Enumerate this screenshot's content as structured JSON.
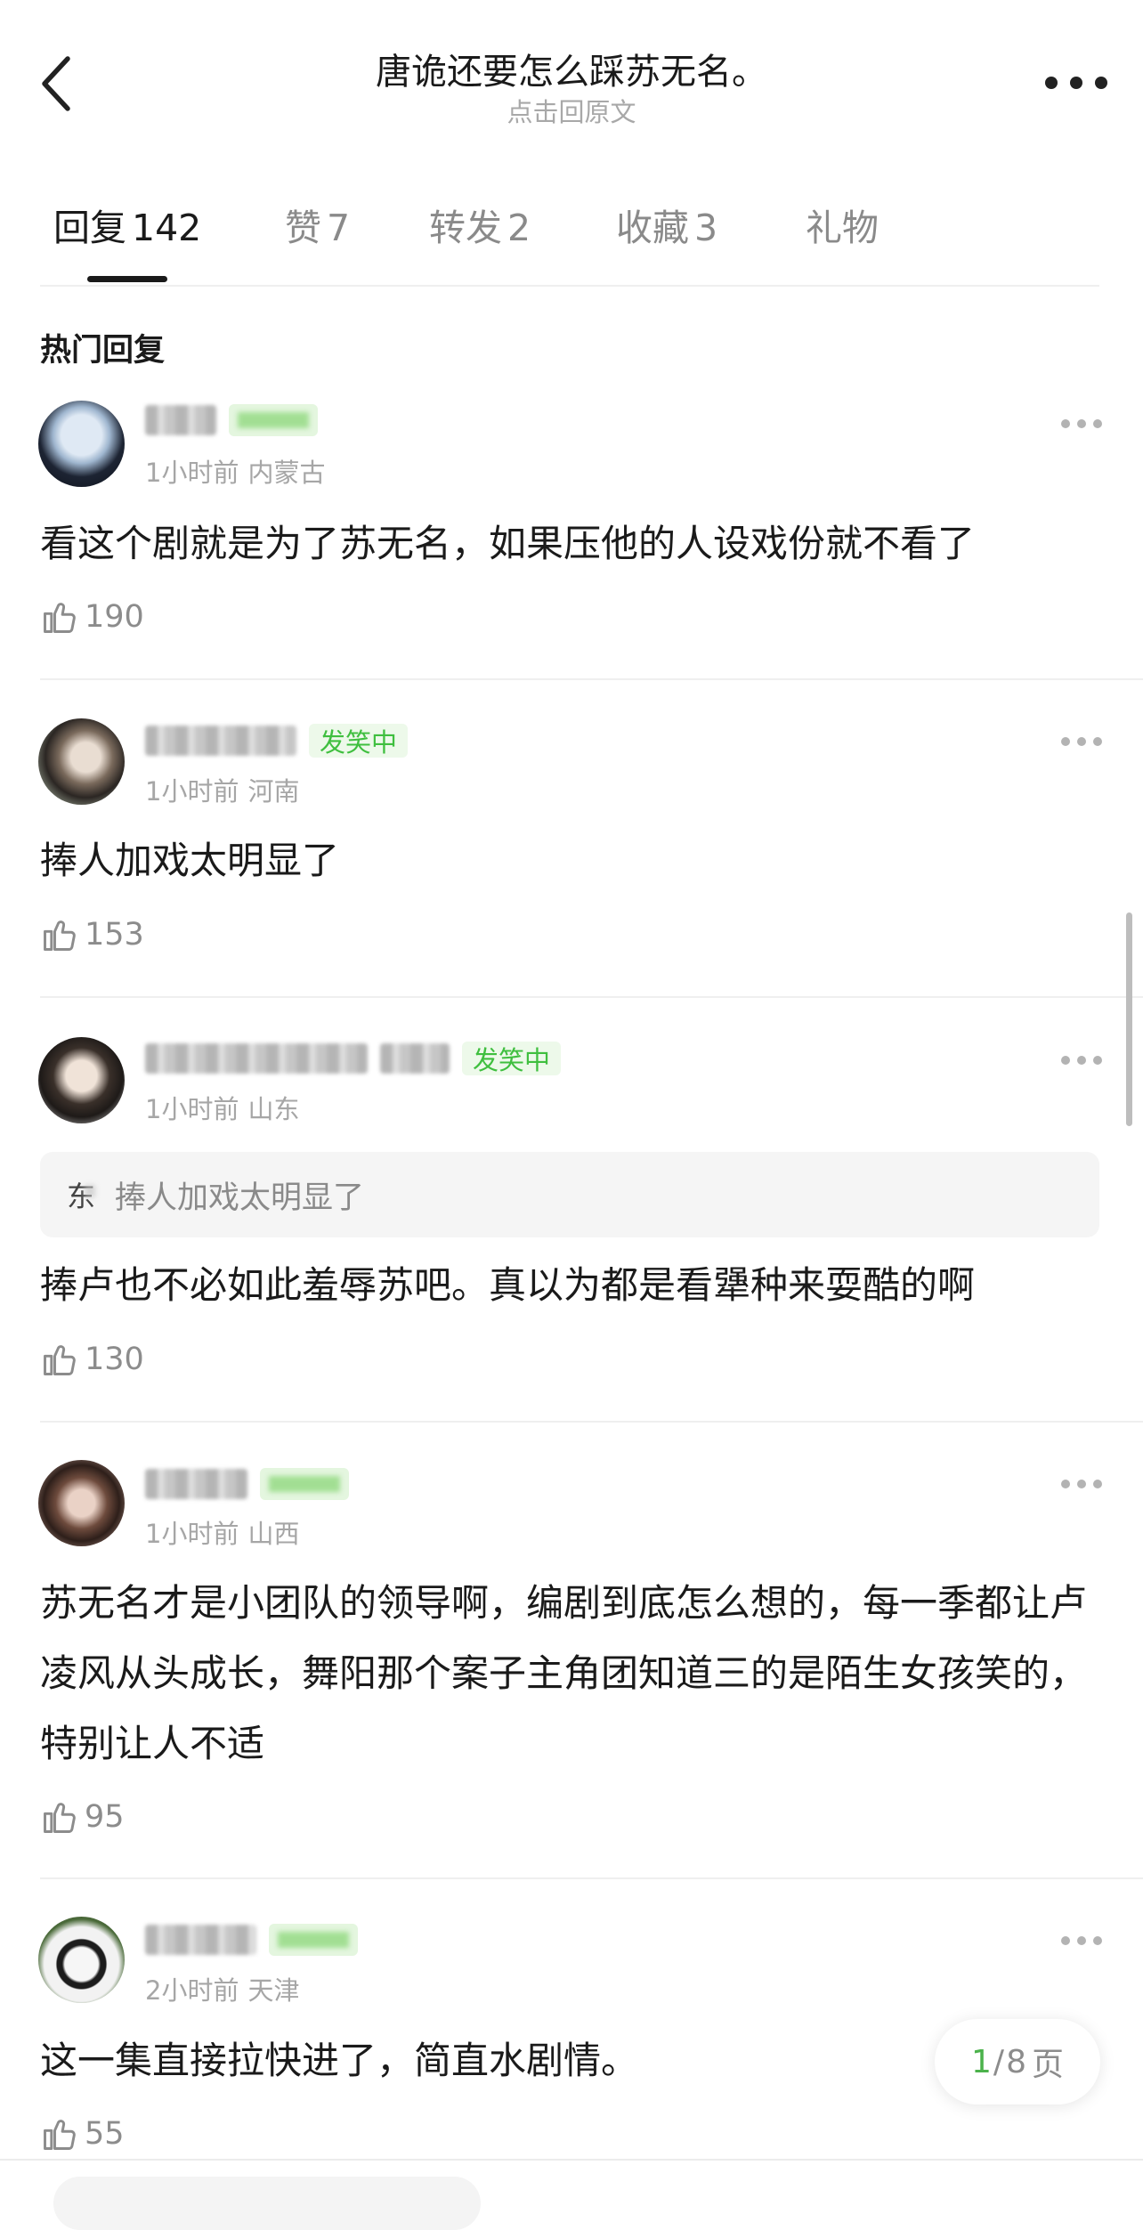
{
  "header": {
    "title": "唐诡还要怎么踩苏无名。",
    "subtitle": "点击回原文"
  },
  "tabs": [
    {
      "label": "回复",
      "count": "142"
    },
    {
      "label": "赞",
      "count": "7"
    },
    {
      "label": "转发",
      "count": "2"
    },
    {
      "label": "收藏",
      "count": "3"
    },
    {
      "label": "礼物",
      "count": ""
    }
  ],
  "section_title": "热门回复",
  "comments": [
    {
      "time": "1小时前",
      "location": "内蒙古",
      "badge": "",
      "content": "看这个剧就是为了苏无名，如果压他的人设戏份就不看了",
      "likes": "190"
    },
    {
      "time": "1小时前",
      "location": "河南",
      "badge": "发笑中",
      "content": "捧人加戏太明显了",
      "likes": "153"
    },
    {
      "time": "1小时前",
      "location": "山东",
      "badge": "发笑中",
      "quote_name": "东",
      "quote_text": "捧人加戏太明显了",
      "content": "捧卢也不必如此羞辱苏吧。真以为都是看犟种来耍酷的啊",
      "likes": "130"
    },
    {
      "time": "1小时前",
      "location": "山西",
      "badge": "",
      "content": "苏无名才是小团队的领导啊，编剧到底怎么想的，每一季都让卢凌风从头成长，舞阳那个案子主角团知道三的是陌生女孩笑的，特别让人不适",
      "likes": "95"
    },
    {
      "time": "2小时前",
      "location": "天津",
      "badge": "",
      "content": "这一集直接拉快进了，简直水剧情。",
      "likes": "55"
    }
  ],
  "pager": {
    "current": "1",
    "separator": "/",
    "total": "8",
    "unit": "页"
  },
  "colors": {
    "accent_green": "#4cb24c",
    "badge_green": "#3fbf3f",
    "text_primary": "#1a1a1a",
    "text_muted": "#a6a6a6"
  },
  "icons": [
    "back-arrow-icon",
    "more-icon",
    "thumbs-up-icon",
    "more-dots-icon"
  ]
}
